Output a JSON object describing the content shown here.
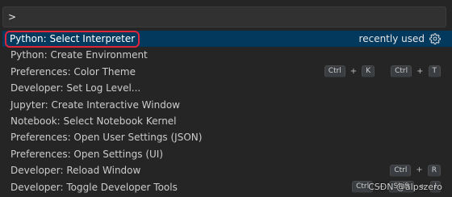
{
  "search": {
    "value": ">"
  },
  "items": [
    {
      "label": "Python: Select Interpreter",
      "tag": "recently used",
      "gear": "gear-icon",
      "selected": true
    },
    {
      "label": "Python: Create Environment"
    },
    {
      "label": "Preferences: Color Theme",
      "keys": [
        [
          "Ctrl",
          "K"
        ],
        [
          "Ctrl",
          "T"
        ]
      ]
    },
    {
      "label": "Developer: Set Log Level..."
    },
    {
      "label": "Jupyter: Create Interactive Window"
    },
    {
      "label": "Notebook: Select Notebook Kernel"
    },
    {
      "label": "Preferences: Open User Settings (JSON)"
    },
    {
      "label": "Preferences: Open Settings (UI)"
    },
    {
      "label": "Developer: Reload Window",
      "keys": [
        [
          "Ctrl",
          "R"
        ]
      ]
    },
    {
      "label": "Developer: Toggle Developer Tools",
      "keys": [
        [
          "Ctrl",
          "Shift",
          "I"
        ]
      ]
    }
  ],
  "plus_sign": "+",
  "watermark": "CSDN @alpszero",
  "colors": {
    "selected_bg": "#04395e",
    "highlight_border": "#e0243a",
    "background": "#252526"
  }
}
